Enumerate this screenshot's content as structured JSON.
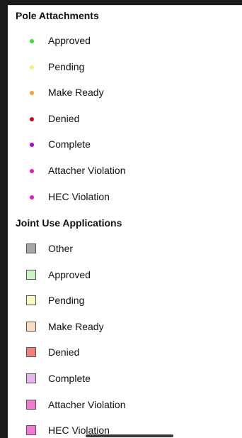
{
  "pole_attachments": {
    "title": "Pole Attachments",
    "items": [
      {
        "label": "Approved",
        "color": "#3ddc2e"
      },
      {
        "label": "Pending",
        "color": "#f5f07a"
      },
      {
        "label": "Make Ready",
        "color": "#f5a623"
      },
      {
        "label": "Denied",
        "color": "#d0021b"
      },
      {
        "label": "Complete",
        "color": "#b000e6"
      },
      {
        "label": "Attacher Violation",
        "color": "#e61ab8"
      },
      {
        "label": "HEC Violation",
        "color": "#e61ab8"
      }
    ]
  },
  "joint_use": {
    "title": "Joint Use Applications",
    "items": [
      {
        "label": "Other",
        "color": "#a6a6a6"
      },
      {
        "label": "Approved",
        "color": "#c9f5c0"
      },
      {
        "label": "Pending",
        "color": "#fbf7c4"
      },
      {
        "label": "Make Ready",
        "color": "#fbdcbd"
      },
      {
        "label": "Denied",
        "color": "#f0807a"
      },
      {
        "label": "Complete",
        "color": "#e6b3f0"
      },
      {
        "label": "Attacher Violation",
        "color": "#f07ad2"
      },
      {
        "label": "HEC Violation",
        "color": "#f07ad2"
      }
    ]
  }
}
